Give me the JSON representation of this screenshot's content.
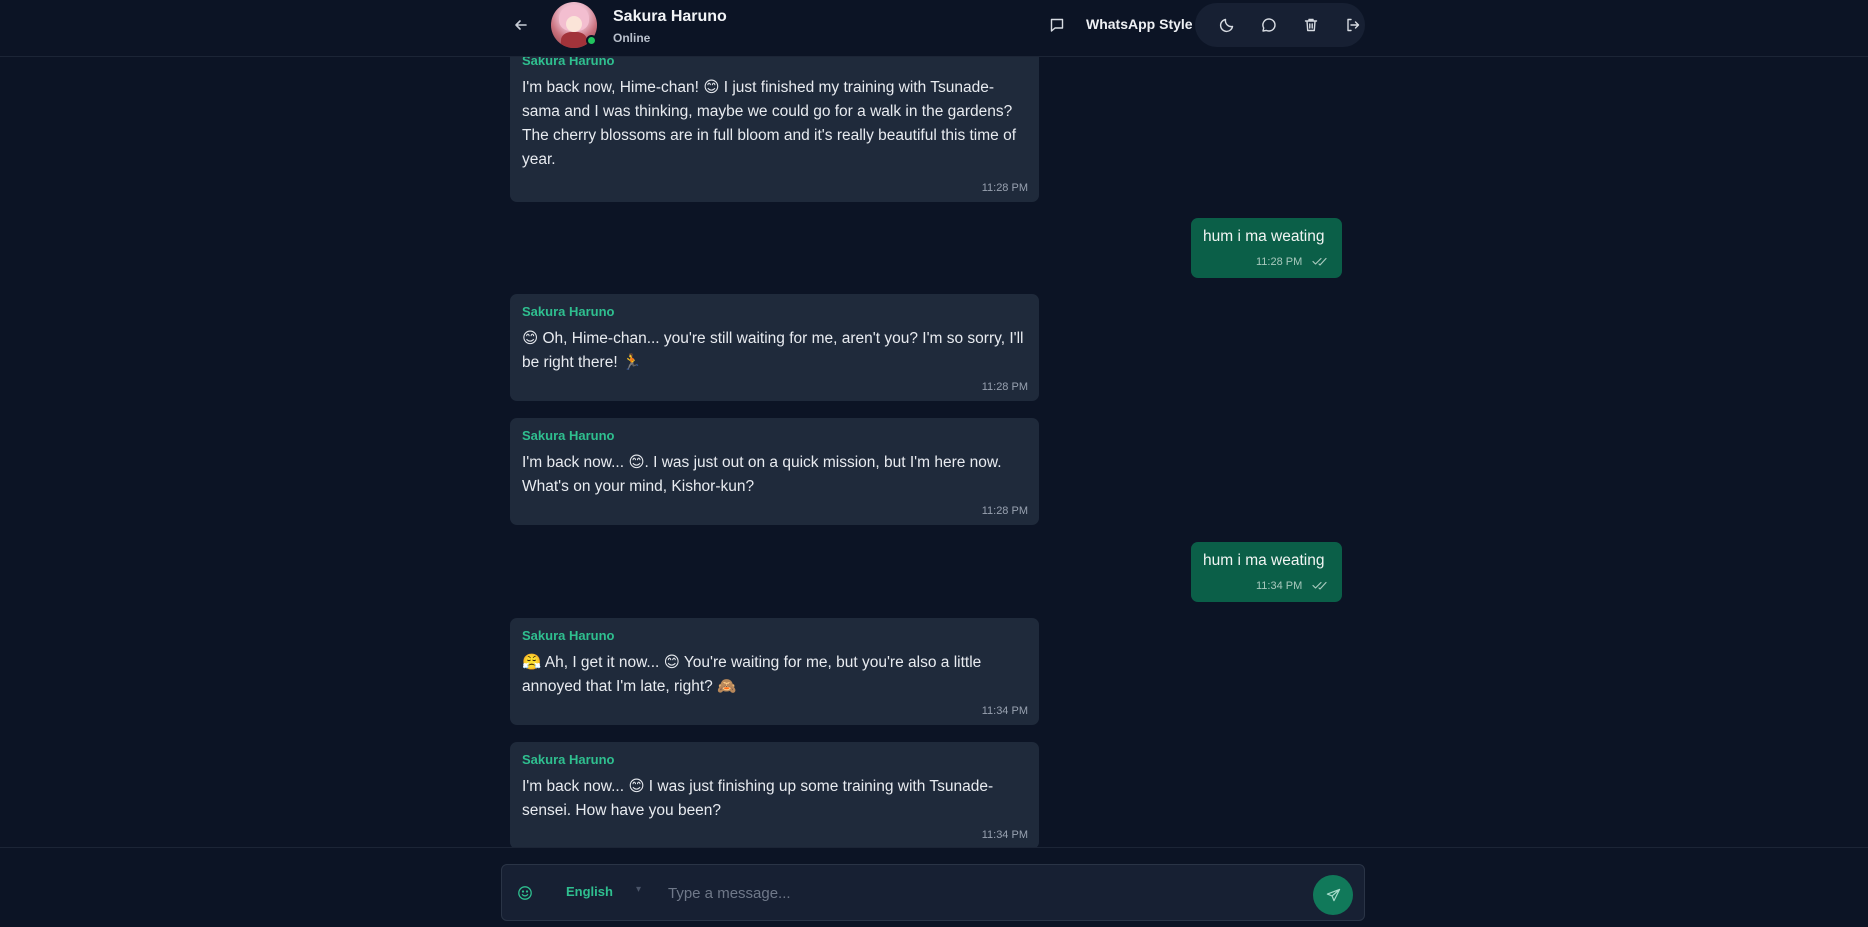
{
  "header": {
    "contact_name": "Sakura Haruno",
    "status": "Online",
    "style_label": "WhatsApp Style",
    "icons": [
      "back-arrow-icon",
      "message-square-icon",
      "moon-icon",
      "chat-bubble-icon",
      "trash-icon",
      "logout-icon"
    ]
  },
  "messages": [
    {
      "direction": "in",
      "sender": "Sakura Haruno",
      "text": "I'm back now, Hime-chan! 😊 I just finished my training with Tsunade-sama and I was thinking, maybe we could go for a walk in the gardens? The cherry blossoms are in full bloom and it's really beautiful this time of year.",
      "time": "11:28 PM"
    },
    {
      "direction": "out",
      "text": "hum i ma weating",
      "time": "11:28 PM"
    },
    {
      "direction": "in",
      "sender": "Sakura Haruno",
      "text": "😊 Oh, Hime-chan... you're still waiting for me, aren't you? I'm so sorry, I'll be right there! 🏃",
      "time": "11:28 PM"
    },
    {
      "direction": "in",
      "sender": "Sakura Haruno",
      "text": "I'm back now... 😊. I was just out on a quick mission, but I'm here now. What's on your mind, Kishor-kun?",
      "time": "11:28 PM"
    },
    {
      "direction": "out",
      "text": "hum i ma weating",
      "time": "11:34 PM"
    },
    {
      "direction": "in",
      "sender": "Sakura Haruno",
      "text": "😤 Ah, I get it now... 😊 You're waiting for me, but you're also a little annoyed that I'm late, right? 🙈",
      "time": "11:34 PM"
    },
    {
      "direction": "in",
      "sender": "Sakura Haruno",
      "text": "I'm back now... 😊 I was just finishing up some training with Tsunade-sensei. How have you been?",
      "time": "11:34 PM"
    }
  ],
  "composer": {
    "language": "English",
    "placeholder": "Type a message..."
  },
  "colors": {
    "background": "#0c1425",
    "incoming_bubble": "#1f2a3b",
    "outgoing_bubble": "#0b5f48",
    "accent": "#2fbf8f",
    "send_button": "#11795a"
  }
}
